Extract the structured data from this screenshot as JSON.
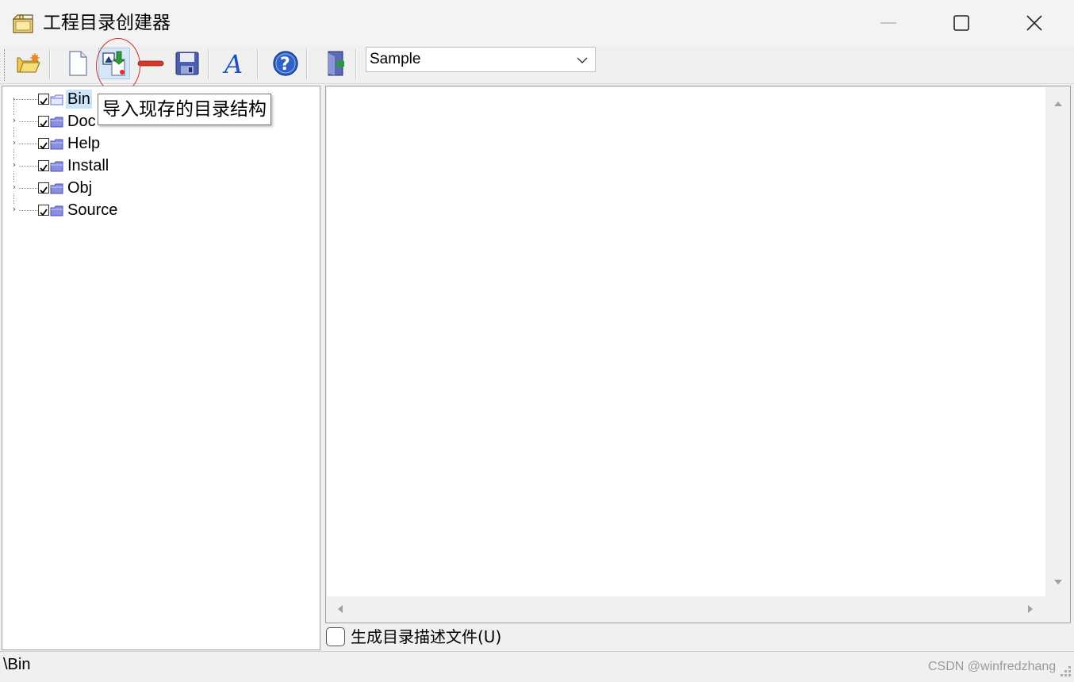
{
  "window": {
    "title": "工程目录创建器"
  },
  "toolbar": {
    "buttons": [
      {
        "name": "open-folder",
        "icon": "folder-open-icon"
      },
      {
        "name": "new",
        "icon": "new-document-icon"
      },
      {
        "name": "import",
        "icon": "import-structure-icon",
        "tooltip": "导入现存的目录结构"
      },
      {
        "name": "remove",
        "icon": "remove-icon"
      },
      {
        "name": "save",
        "icon": "floppy-disk-icon"
      },
      {
        "name": "font",
        "icon": "font-icon"
      },
      {
        "name": "help",
        "icon": "help-icon"
      },
      {
        "name": "exit",
        "icon": "exit-door-icon"
      }
    ],
    "template_select": {
      "value": "Sample"
    }
  },
  "tree": {
    "items": [
      {
        "label": "Bin",
        "checked": true,
        "selected": true,
        "expandable": false
      },
      {
        "label": "Doc",
        "checked": true,
        "selected": false,
        "expandable": true
      },
      {
        "label": "Help",
        "checked": true,
        "selected": false,
        "expandable": true
      },
      {
        "label": "Install",
        "checked": true,
        "selected": false,
        "expandable": true
      },
      {
        "label": "Obj",
        "checked": true,
        "selected": false,
        "expandable": true
      },
      {
        "label": "Source",
        "checked": true,
        "selected": false,
        "expandable": true
      }
    ]
  },
  "tooltip": {
    "text": "导入现存的目录结构"
  },
  "options": {
    "generate_desc_label": "生成目录描述文件(U)",
    "generate_desc_checked": false
  },
  "status": {
    "path": "\\Bin",
    "watermark": "CSDN @winfredzhang"
  },
  "colors": {
    "selection": "#cce4f7",
    "highlight_circle": "#d23030",
    "folder": "#8a8ee0"
  }
}
